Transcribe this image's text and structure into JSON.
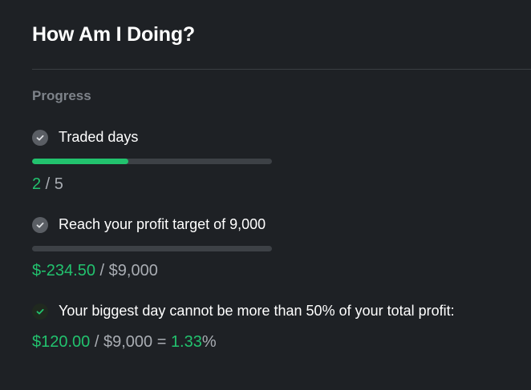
{
  "header": {
    "title": "How Am I Doing?"
  },
  "progress": {
    "section_label": "Progress",
    "traded_days": {
      "label": "Traded days",
      "current": "2",
      "separator": " / ",
      "target": "5",
      "progress_fraction": 0.4,
      "status_icon": "check-circle-icon"
    },
    "profit_target": {
      "label": "Reach your profit target of 9,000",
      "current": "$-234.50",
      "separator": " / ",
      "target": "$9,000",
      "progress_fraction": 0,
      "status_icon": "check-circle-icon"
    },
    "biggest_day": {
      "label": "Your biggest day cannot be more than 50% of your total profit:",
      "day_value": "$120.00",
      "separator": " / ",
      "total": "$9,000",
      "equals": " = ",
      "percent_value": "1.33",
      "percent_sign": "%",
      "status_icon": "check-circle-icon"
    }
  },
  "colors": {
    "background": "#1e2125",
    "accent_green": "#22c26e",
    "muted_text": "#a9adb3",
    "section_label": "#7e838a",
    "track": "#3d4146"
  }
}
